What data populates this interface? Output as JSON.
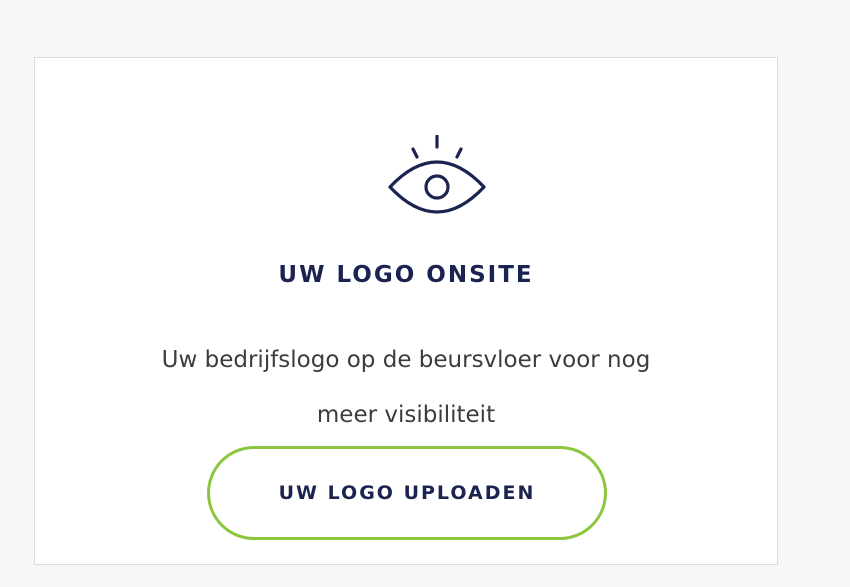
{
  "card": {
    "icon": "eye-icon",
    "title": "UW LOGO ONSITE",
    "description_line1": "Uw bedrijfslogo op de beursvloer voor nog",
    "description_line2": "meer visibiliteit",
    "button_label": "UW LOGO UPLOADEN"
  },
  "colors": {
    "navy": "#1b2350",
    "accent_green": "#8cc63f",
    "text_gray": "#3c3c3c",
    "border": "#d9dce2"
  }
}
